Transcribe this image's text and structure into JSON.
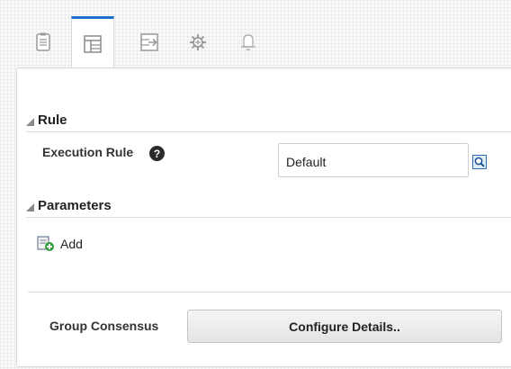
{
  "tabs": [
    {
      "icon": "clipboard-icon",
      "active": false
    },
    {
      "icon": "layout-icon",
      "active": true
    },
    {
      "icon": "export-icon",
      "active": false
    },
    {
      "icon": "gear-icon",
      "active": false
    },
    {
      "icon": "bell-icon",
      "active": false
    }
  ],
  "rule_section": {
    "title": "Rule",
    "execution_rule_label": "Execution Rule",
    "help_icon": "?",
    "execution_rule_value": "Default",
    "search_icon": "search-icon"
  },
  "parameters_section": {
    "title": "Parameters",
    "add_label": "Add",
    "add_icon": "add-document-icon"
  },
  "group_consensus": {
    "label": "Group Consensus",
    "button_label": "Configure Details.."
  },
  "colors": {
    "accent": "#1f6fcf",
    "add_icon_green": "#2e9e3a"
  }
}
